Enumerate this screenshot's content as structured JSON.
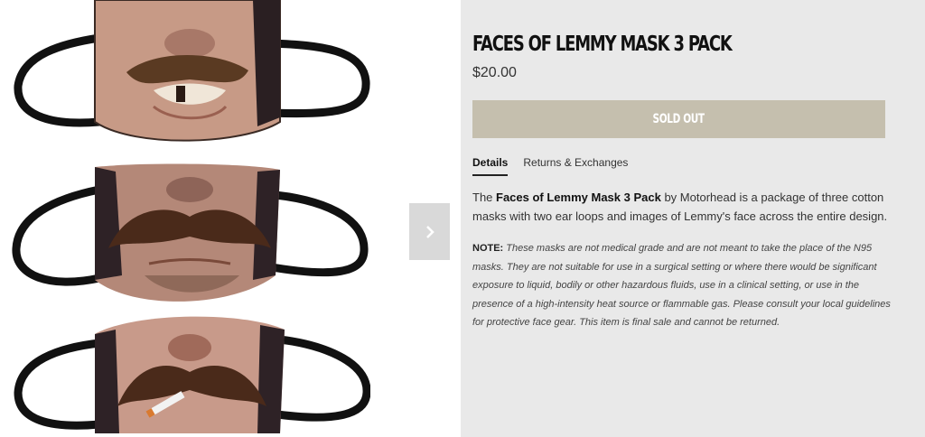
{
  "product": {
    "title": "FACES OF LEMMY MASK 3 PACK",
    "price": "$20.00",
    "button_label": "SOLD OUT",
    "accent_color": "#c5bfae"
  },
  "tabs": [
    {
      "label": "Details",
      "active": true
    },
    {
      "label": "Returns & Exchanges",
      "active": false
    }
  ],
  "description": {
    "prefix": "The ",
    "bold": "Faces of Lemmy Mask 3 Pack",
    "suffix": " by Motorhead is a package of three cotton masks with two ear loops and images of Lemmy's face across the entire design."
  },
  "note": {
    "label": "NOTE:",
    "text": " These masks are not medical grade and are not meant to take the place of the N95 masks. They are not suitable for use in a surgical setting or where there would be significant exposure to liquid, bodily or other hazardous fluids, use in a clinical setting, or use in the presence of a high-intensity heat source or flammable gas. Please consult your local guidelines for protective face gear. This item is final sale and cannot be returned."
  },
  "gallery": {
    "next_icon": "chevron-right-icon"
  }
}
